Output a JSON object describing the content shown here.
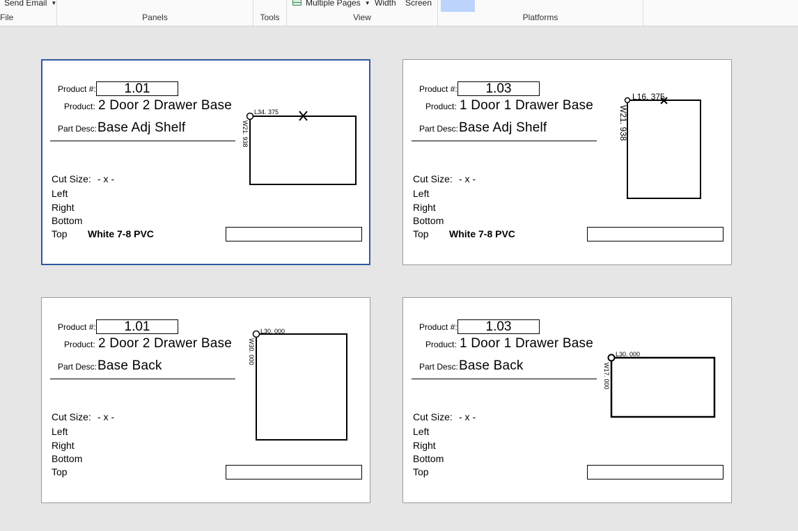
{
  "ribbon": {
    "file_group": {
      "item": "Send Email",
      "label": "File"
    },
    "panels_group": {
      "label": "Panels"
    },
    "tools_group": {
      "label": "Tools"
    },
    "view_group": {
      "item_pages": "Multiple Pages",
      "item_width": "Width",
      "item_screen": "Screen",
      "label": "View"
    },
    "platforms_group": {
      "label": "Platforms"
    }
  },
  "labels": {
    "product_num": "Product #:",
    "product": "Product:",
    "part_desc": "Part Desc:",
    "cut_size": "Cut Size:",
    "left": "Left",
    "right": "Right",
    "bottom": "Bottom",
    "top": "Top"
  },
  "cards": [
    {
      "product_num": "1.01",
      "product": "2 Door 2 Drawer Base",
      "part_desc": "Base Adj Shelf",
      "cut_size": "- x -",
      "top_edge": "White 7-8 PVC",
      "length_label": "L34. 375",
      "width_label": "W21. 938",
      "selected": true
    },
    {
      "product_num": "1.03",
      "product": "1 Door 1 Drawer Base",
      "part_desc": "Base Adj Shelf",
      "cut_size": "- x -",
      "top_edge": "White 7-8 PVC",
      "length_label": "L16. 375",
      "width_label": "W21. 938",
      "selected": false
    },
    {
      "product_num": "1.01",
      "product": "2 Door 2 Drawer Base",
      "part_desc": "Base Back",
      "cut_size": "- x -",
      "top_edge": "",
      "length_label": "L30. 000",
      "width_label": "W30. 000",
      "selected": false
    },
    {
      "product_num": "1.03",
      "product": "1 Door 1 Drawer Base",
      "part_desc": "Base Back",
      "cut_size": "- x -",
      "top_edge": "",
      "length_label": "L30. 000",
      "width_label": "W17. 000",
      "selected": false
    }
  ]
}
